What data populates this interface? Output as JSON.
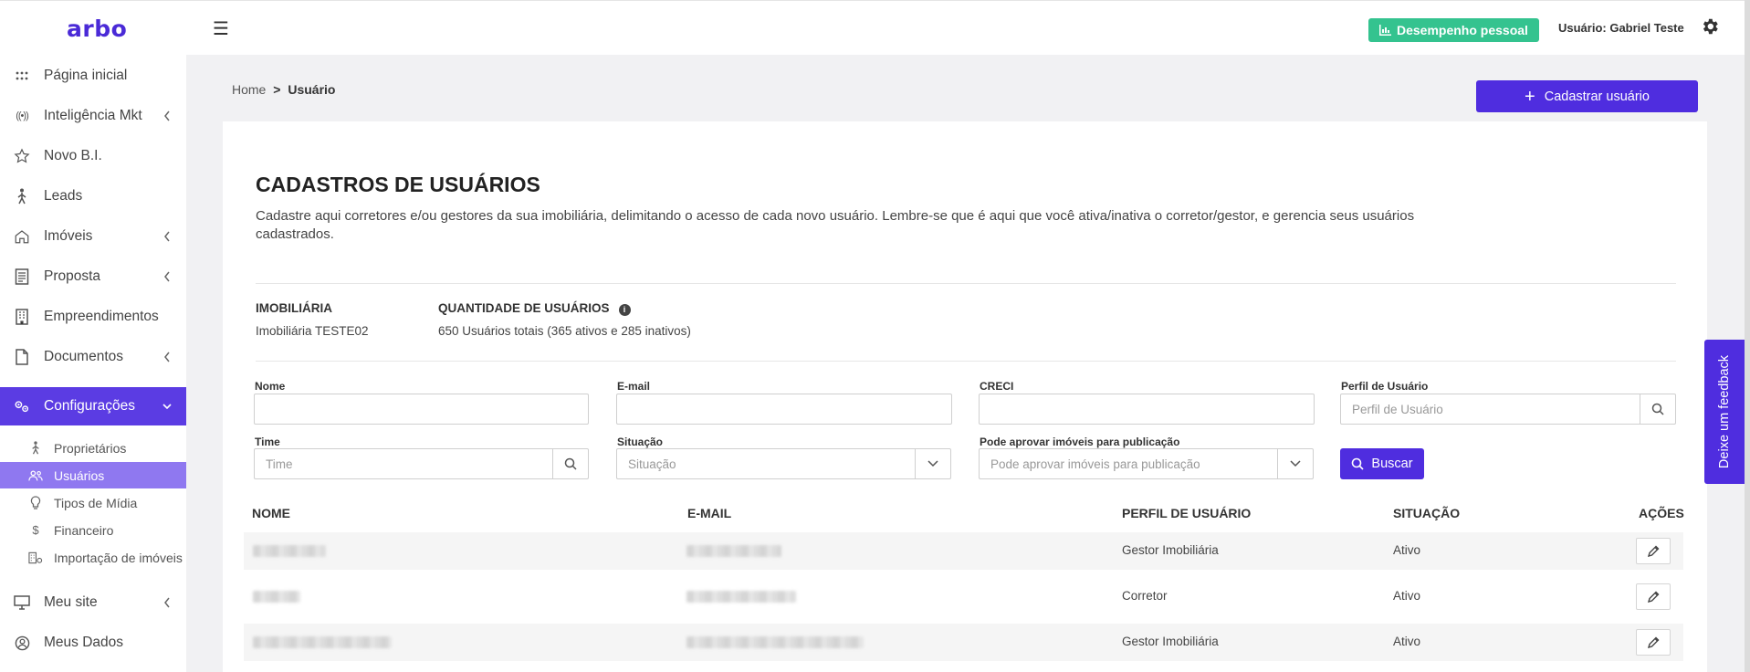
{
  "brand": {
    "logo": "arbo",
    "accent": "#4f2ddf",
    "success": "#34c38f"
  },
  "header": {
    "menu_icon": "hamburger-icon",
    "performance_label": "Desempenho pessoal",
    "user_prefix": "Usuário: ",
    "user_name": "Gabriel Teste"
  },
  "sidebar": {
    "items": [
      {
        "label": "Página inicial",
        "icon": "grid-dots-icon"
      },
      {
        "label": "Inteligência Mkt",
        "icon": "broadcast-icon"
      },
      {
        "label": "Novo B.I.",
        "icon": "star-icon"
      },
      {
        "label": "Leads",
        "icon": "person-walk-icon"
      },
      {
        "label": "Imóveis",
        "icon": "house-icon"
      },
      {
        "label": "Proposta",
        "icon": "document-icon"
      },
      {
        "label": "Empreendimentos",
        "icon": "building-icon"
      },
      {
        "label": "Documentos",
        "icon": "file-icon"
      },
      {
        "label": "Configurações",
        "icon": "gears-icon"
      }
    ],
    "sub_items": [
      {
        "label": "Proprietários",
        "icon": "person-walk-icon"
      },
      {
        "label": "Usuários",
        "icon": "users-icon"
      },
      {
        "label": "Tipos de Mídia",
        "icon": "lightbulb-icon"
      },
      {
        "label": "Financeiro",
        "icon": "dollar-icon"
      },
      {
        "label": "Importação de imóveis",
        "icon": "building-gear-icon"
      }
    ],
    "bottom_items": [
      {
        "label": "Meu site",
        "icon": "monitor-icon"
      },
      {
        "label": "Meus Dados",
        "icon": "user-circle-icon"
      }
    ]
  },
  "breadcrumb": {
    "home": "Home",
    "separator": ">",
    "current": "Usuário"
  },
  "add_user_label": "Cadastrar usuário",
  "main": {
    "title": "CADASTROS DE USUÁRIOS",
    "description": "Cadastre aqui corretores e/ou gestores da sua imobiliária, delimitando o acesso de cada novo usuário. Lembre-se que é aqui que você ativa/inativa o corretor/gestor, e gerencia seus usuários cadastrados.",
    "agency_label": "IMOBILIÁRIA",
    "agency_value": "Imobiliária TESTE02",
    "count_label": "QUANTIDADE DE USUÁRIOS",
    "count_value": "650 Usuários totais (365 ativos e 285 inativos)"
  },
  "filters": {
    "name_label": "Nome",
    "email_label": "E-mail",
    "creci_label": "CRECI",
    "profile_label": "Perfil de Usuário",
    "profile_placeholder": "Perfil de Usuário",
    "team_label": "Time",
    "team_placeholder": "Time",
    "status_label": "Situação",
    "status_placeholder": "Situação",
    "approve_label": "Pode aprovar imóveis para publicação",
    "approve_placeholder": "Pode aprovar imóveis para publicação",
    "search_label": "Buscar"
  },
  "table": {
    "headers": [
      "NOME",
      "E-MAIL",
      "PERFIL DE USUÁRIO",
      "SITUAÇÃO",
      "AÇÕES"
    ],
    "rows": [
      {
        "profile": "Gestor Imobiliária",
        "status": "Ativo"
      },
      {
        "profile": "Corretor",
        "status": "Ativo"
      },
      {
        "profile": "Gestor Imobiliária",
        "status": "Ativo"
      }
    ]
  },
  "feedback_label": "Deixe um feedback"
}
